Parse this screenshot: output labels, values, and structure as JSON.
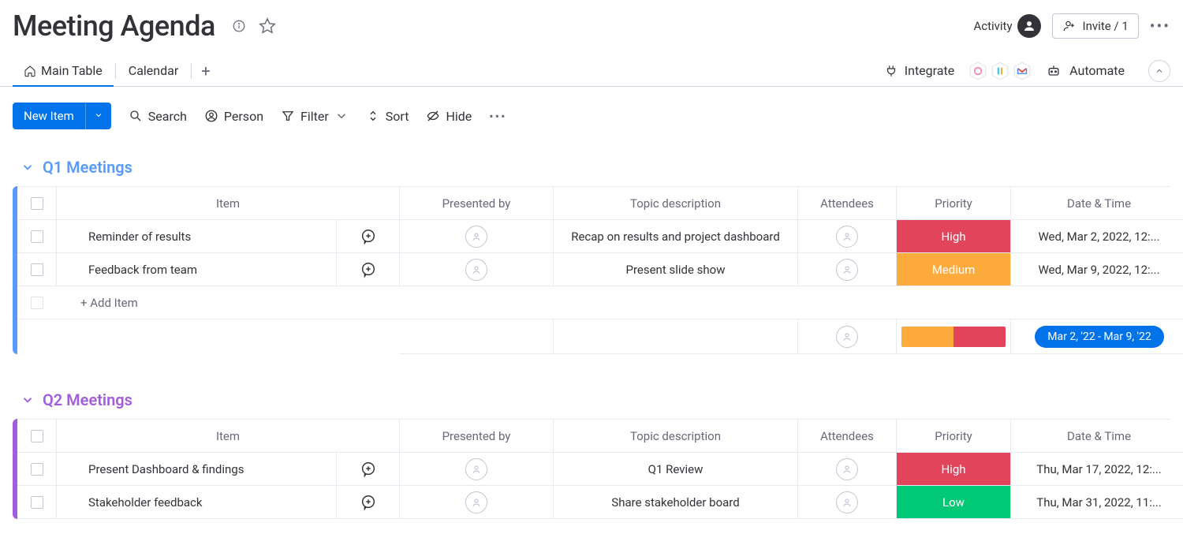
{
  "header": {
    "title": "Meeting Agenda",
    "activity_label": "Activity",
    "invite_label": "Invite / 1"
  },
  "tabs": {
    "main_table": "Main Table",
    "calendar": "Calendar",
    "integrate": "Integrate",
    "automate": "Automate"
  },
  "toolbar": {
    "new_item": "New Item",
    "search": "Search",
    "person": "Person",
    "filter": "Filter",
    "sort": "Sort",
    "hide": "Hide"
  },
  "columns": {
    "item": "Item",
    "presented_by": "Presented by",
    "topic": "Topic description",
    "attendees": "Attendees",
    "priority": "Priority",
    "datetime": "Date & Time"
  },
  "groups": [
    {
      "name": "Q1 Meetings",
      "color": "blue",
      "rows": [
        {
          "item": "Reminder of results",
          "topic": "Recap on results and project dashboard",
          "priority": "High",
          "priority_class": "prio-high",
          "datetime": "Wed, Mar 2, 2022, 12:..."
        },
        {
          "item": "Feedback from team",
          "topic": "Present slide show",
          "priority": "Medium",
          "priority_class": "prio-med",
          "datetime": "Wed, Mar 9, 2022, 12:..."
        }
      ],
      "add_item_label": "+ Add Item",
      "summary_date": "Mar 2, '22 - Mar 9, '22"
    },
    {
      "name": "Q2 Meetings",
      "color": "purple",
      "rows": [
        {
          "item": "Present Dashboard & findings",
          "topic": "Q1 Review",
          "priority": "High",
          "priority_class": "prio-high",
          "datetime": "Thu, Mar 17, 2022, 12:..."
        },
        {
          "item": "Stakeholder feedback",
          "topic": "Share stakeholder board",
          "priority": "Low",
          "priority_class": "prio-low",
          "datetime": "Thu, Mar 31, 2022, 11:..."
        }
      ]
    }
  ]
}
